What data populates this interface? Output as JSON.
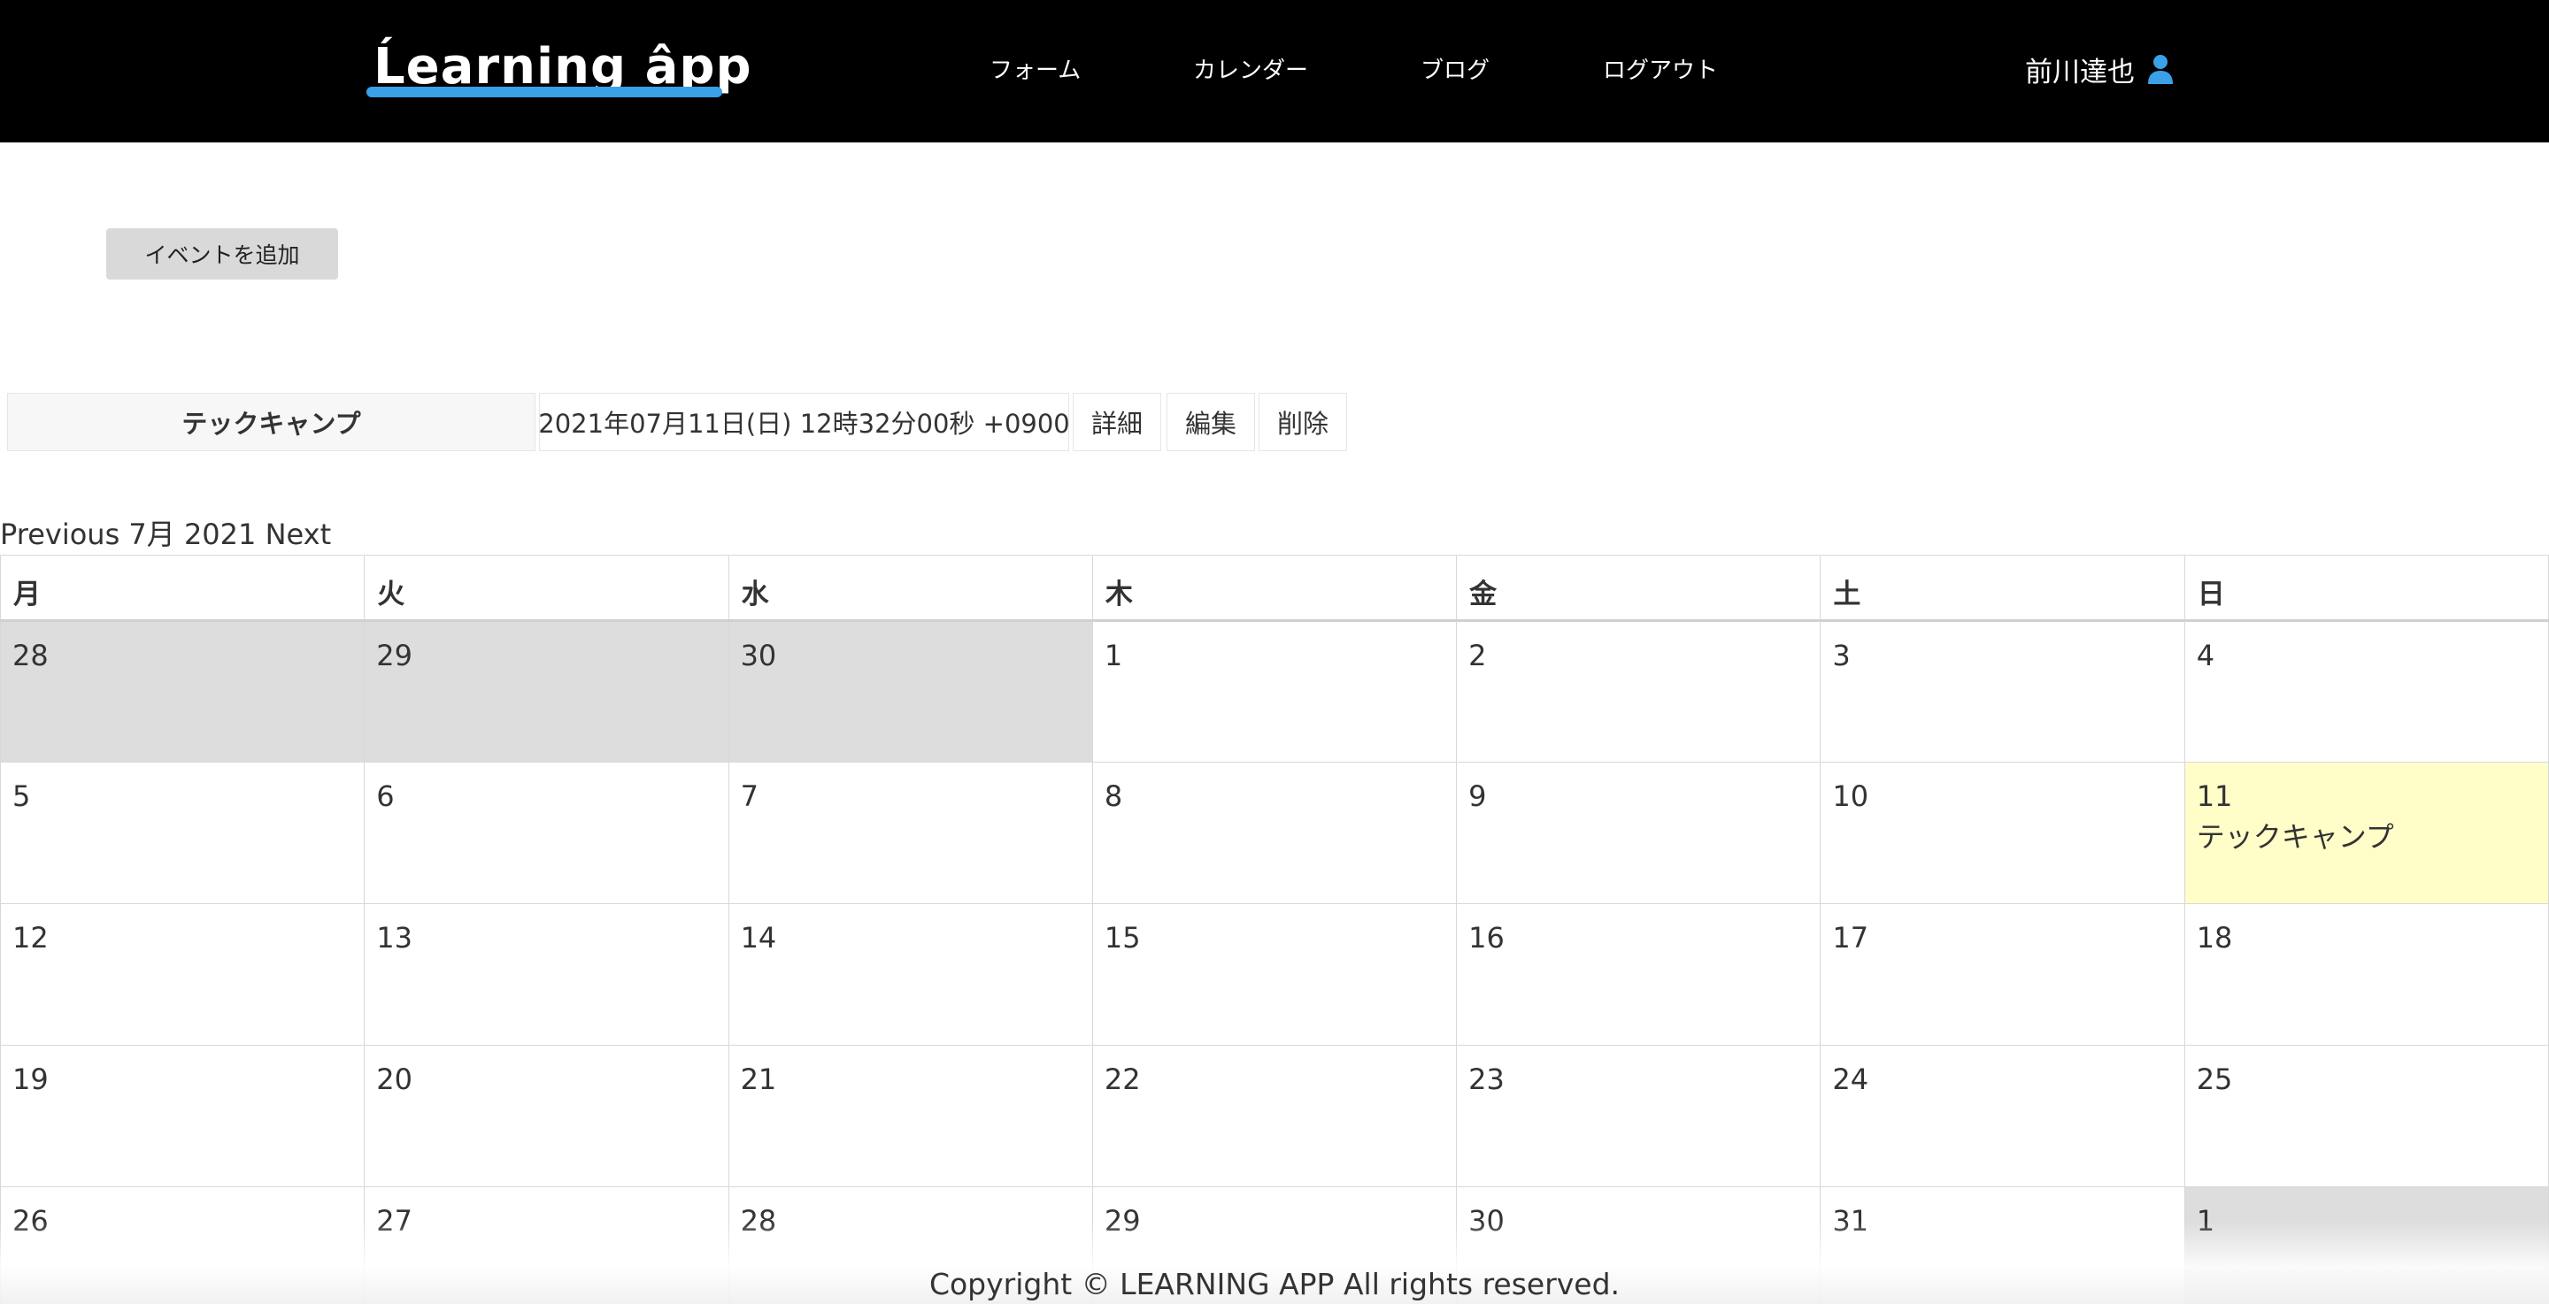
{
  "header": {
    "logo": "Ĺearning âpp",
    "nav": {
      "form": "フォーム",
      "calendar": "カレンダー",
      "blog": "ブログ",
      "logout": "ログアウト"
    },
    "user_name": "前川達也",
    "user_icon": "person-icon"
  },
  "toolbar": {
    "add_event": "イベントを追加"
  },
  "event_row": {
    "title": "テックキャンプ",
    "datetime": "2021年07月11日(日) 12時32分00秒 +0900",
    "detail": "詳細",
    "edit": "編集",
    "delete": "削除"
  },
  "month_nav": {
    "previous": "Previous",
    "current": "7月 2021",
    "next": "Next"
  },
  "calendar": {
    "weekdays": [
      "月",
      "火",
      "水",
      "木",
      "金",
      "土",
      "日"
    ],
    "weeks": [
      [
        {
          "day": "28",
          "other": true
        },
        {
          "day": "29",
          "other": true
        },
        {
          "day": "30",
          "other": true
        },
        {
          "day": "1"
        },
        {
          "day": "2"
        },
        {
          "day": "3"
        },
        {
          "day": "4"
        }
      ],
      [
        {
          "day": "5"
        },
        {
          "day": "6"
        },
        {
          "day": "7"
        },
        {
          "day": "8"
        },
        {
          "day": "9"
        },
        {
          "day": "10"
        },
        {
          "day": "11",
          "today": true,
          "event": "テックキャンプ"
        }
      ],
      [
        {
          "day": "12"
        },
        {
          "day": "13"
        },
        {
          "day": "14"
        },
        {
          "day": "15"
        },
        {
          "day": "16"
        },
        {
          "day": "17"
        },
        {
          "day": "18"
        }
      ],
      [
        {
          "day": "19"
        },
        {
          "day": "20"
        },
        {
          "day": "21"
        },
        {
          "day": "22"
        },
        {
          "day": "23"
        },
        {
          "day": "24"
        },
        {
          "day": "25"
        }
      ],
      [
        {
          "day": "26"
        },
        {
          "day": "27"
        },
        {
          "day": "28"
        },
        {
          "day": "29"
        },
        {
          "day": "30"
        },
        {
          "day": "31"
        },
        {
          "day": "1",
          "other": true
        }
      ]
    ]
  },
  "footer": {
    "copyright": "Copyright © LEARNING APP All rights reserved."
  },
  "colors": {
    "header_bg": "#000000",
    "accent": "#3aa0e8",
    "other_month": "#dddddd",
    "today": "#fffdc8"
  }
}
